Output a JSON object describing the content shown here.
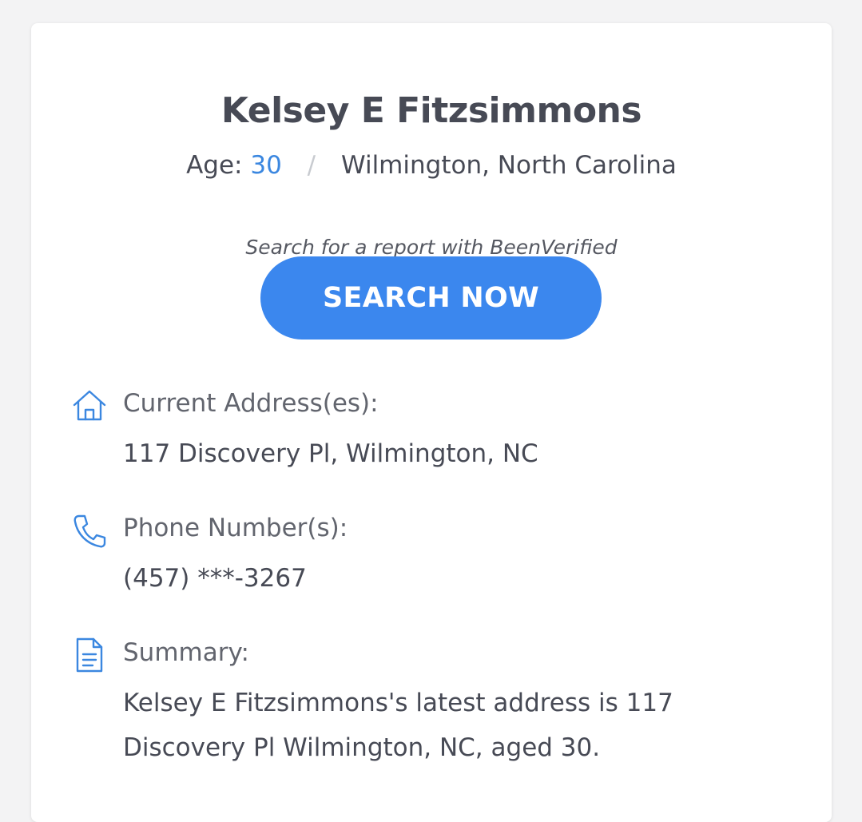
{
  "person": {
    "name": "Kelsey E Fitzsimmons",
    "age_label": "Age:",
    "age_value": "30",
    "separator": "/",
    "location": "Wilmington, North Carolina"
  },
  "cta": {
    "hint": "Search for a report with BeenVerified",
    "button_label": "SEARCH NOW"
  },
  "sections": {
    "address": {
      "icon": "home-icon",
      "label": "Current Address(es):",
      "value": "117 Discovery Pl, Wilmington, NC"
    },
    "phone": {
      "icon": "phone-icon",
      "label": "Phone Number(s):",
      "value": "(457) ***-3267"
    },
    "summary": {
      "icon": "document-icon",
      "label": "Summary:",
      "value": "Kelsey E Fitzsimmons's latest address is 117 Discovery Pl Wilmington, NC, aged 30."
    }
  },
  "colors": {
    "accent": "#3b87ee",
    "text": "#474a55",
    "muted": "#62656e",
    "background": "#f3f3f4"
  }
}
